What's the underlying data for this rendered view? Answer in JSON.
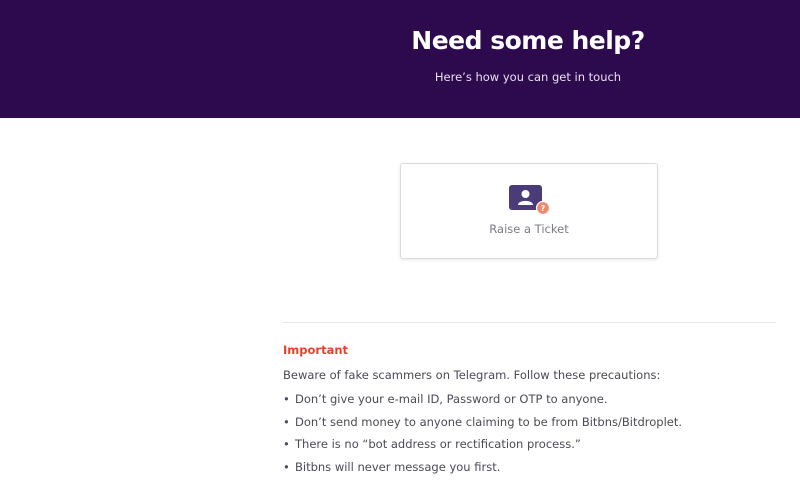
{
  "hero": {
    "title": "Need some help?",
    "subtitle": "Here’s how you can get in touch",
    "background_color": "#2d0a4e"
  },
  "contact_options": [
    {
      "label": "Raise a Ticket",
      "icon": "ticket-support-icon"
    }
  ],
  "notice": {
    "heading": "Important",
    "heading_color": "#e0442c",
    "intro": "Beware of fake scammers on Telegram. Follow these precautions:",
    "precautions": [
      "Don’t give your e-mail ID, Password or OTP to anyone.",
      "Don’t send money to anyone claiming to be from Bitbns/Bitdroplet.",
      "There is no “bot address or rectification process.”",
      "Bitbns will never message you first."
    ]
  }
}
